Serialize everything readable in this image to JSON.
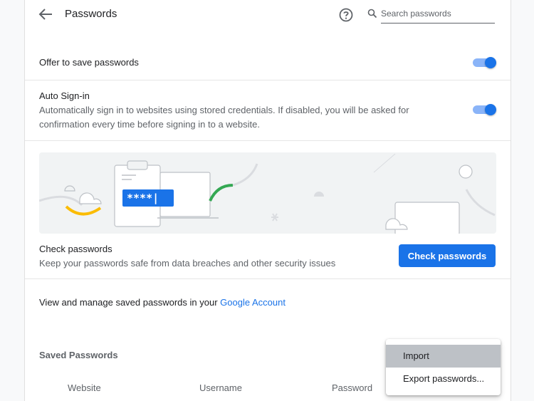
{
  "header": {
    "title": "Passwords",
    "back_icon": "arrow-back-icon",
    "help_icon": "help-circle-icon",
    "search_icon": "search-icon",
    "search_placeholder": "Search passwords",
    "search_value": ""
  },
  "settings": {
    "offer_to_save": {
      "label": "Offer to save passwords",
      "enabled": true
    },
    "auto_signin": {
      "label": "Auto Sign-in",
      "description": "Automatically sign in to websites using stored credentials. If disabled, you will be asked for confirmation every time before signing in to a website.",
      "enabled": true
    }
  },
  "check": {
    "illustration_password": "****|",
    "title": "Check passwords",
    "description": "Keep your passwords safe from data breaches and other security issues",
    "button_label": "Check passwords"
  },
  "manage": {
    "text": "View and manage saved passwords in your ",
    "link_label": "Google Account"
  },
  "saved": {
    "title": "Saved Passwords",
    "columns": [
      "Website",
      "Username",
      "Password"
    ]
  },
  "menu": {
    "items": [
      {
        "label": "Import",
        "highlighted": true
      },
      {
        "label": "Export passwords..."
      }
    ]
  },
  "colors": {
    "accent": "#1a73e8",
    "toggle_track": "#8ab4f8",
    "menu_highlight": "#bdc1c6",
    "illus_green": "#34a853",
    "illus_yellow": "#fbbc04"
  }
}
